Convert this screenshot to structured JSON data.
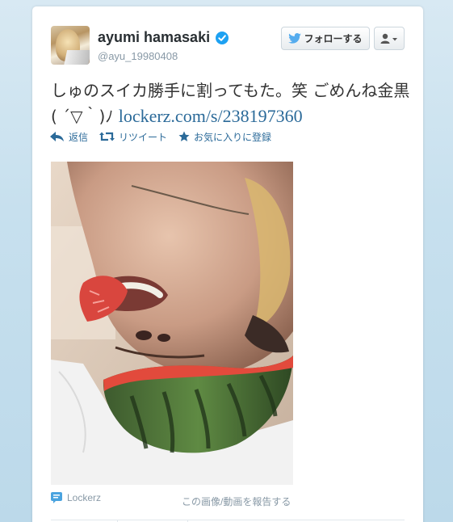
{
  "user": {
    "display_name": "ayumi hamasaki",
    "handle": "@ayu_19980408",
    "verified": true
  },
  "header": {
    "follow_label": "フォローする",
    "user_menu_icon": "user-dropdown-icon"
  },
  "tweet": {
    "text_line1": "しゅのスイカ勝手に割ってもた。笑 ごめんね金黒",
    "text_line2_prefix": "( ´▽｀)ﾉ ",
    "link_text": "lockerz.com/s/238197360"
  },
  "actions": {
    "reply_label": "返信",
    "retweet_label": "リツイート",
    "favorite_label": "お気に入りに登録"
  },
  "media": {
    "source_label": "Lockerz",
    "report_label": "この画像/動画を報告する"
  },
  "colors": {
    "link": "#2b6a99",
    "twitter_blue": "#55acee",
    "verified_blue": "#1da1f2",
    "background": "#c0deed"
  }
}
